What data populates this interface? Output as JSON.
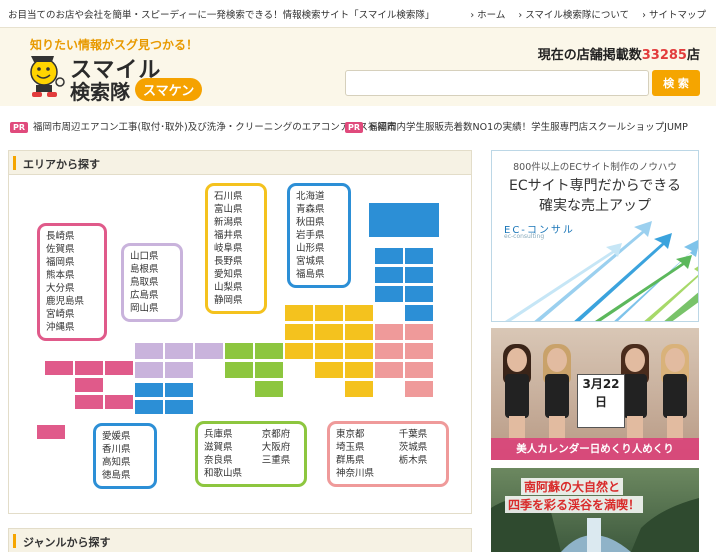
{
  "topbar": {
    "tagline": "お目当てのお店や会社を簡単・スピーディーに一発検索できる！情報検索サイト「スマイル検索隊」",
    "nav": [
      "› ホーム",
      "› スマイル検索隊について",
      "› サイトマップ"
    ]
  },
  "header": {
    "catch": "知りたい情報がスグ見つかる！",
    "logo_line1": "スマイル",
    "logo_line2": "検索隊",
    "logo_badge": "スマケン",
    "count_prefix": "現在の店舗掲載数",
    "count_num": "33285",
    "count_suffix": "店",
    "search_placeholder": "",
    "search_button": "検 索"
  },
  "pr": [
    {
      "tag": "PR",
      "text": "福岡市周辺エアコン工事(取付･取外)及び洗浄・クリーニングのエアコンアシスト福岡"
    },
    {
      "tag": "PR",
      "text": "福岡市内学生服販売着数NO1の実績！学生服専門店スクールショップJUMP"
    }
  ],
  "area": {
    "title": "エリアから探す",
    "regions": {
      "kyushu": [
        "長崎県",
        "佐賀県",
        "福岡県",
        "熊本県",
        "大分県",
        "鹿児島県",
        "宮崎県",
        "沖縄県"
      ],
      "chugoku": [
        "山口県",
        "島根県",
        "鳥取県",
        "広島県",
        "岡山県"
      ],
      "chubu": [
        "石川県",
        "富山県",
        "新潟県",
        "福井県",
        "岐阜県",
        "長野県",
        "愛知県",
        "山梨県",
        "静岡県"
      ],
      "tohoku": [
        "北海道",
        "青森県",
        "秋田県",
        "岩手県",
        "山形県",
        "宮城県",
        "福島県"
      ],
      "shikoku": [
        "愛媛県",
        "香川県",
        "高知県",
        "徳島県"
      ],
      "kinki": [
        "兵庫県",
        "京都府",
        "滋賀県",
        "大阪府",
        "奈良県",
        "三重県",
        "和歌山県"
      ],
      "kanto": [
        "東京都",
        "千葉県",
        "埼玉県",
        "茨城県",
        "群馬県",
        "栃木県",
        "神奈川県"
      ]
    }
  },
  "genre": {
    "title": "ジャンルから探す"
  },
  "ads": {
    "ec": {
      "line1": "800件以上のECサイト制作のノウハウ",
      "line2": "ECサイト専門だからできる",
      "line3": "確実な売上アップ",
      "brand": "EC-コンサル",
      "brand_sub": "ec-consulting"
    },
    "calendar": {
      "date": "3月22日",
      "caption": "美人カレンダー日めくり人めくり"
    },
    "aso": {
      "line1": "南阿蘇の大自然と",
      "line2": "四季を彩る渓谷を満喫！"
    }
  },
  "colors": {
    "accent": "#f5a500",
    "pink": "#e05a8a",
    "purple": "#c9b3dc",
    "green": "#8dc63f",
    "yellow": "#f4c21e",
    "blue": "#2c8fd6",
    "salmon": "#ef9a9a"
  }
}
